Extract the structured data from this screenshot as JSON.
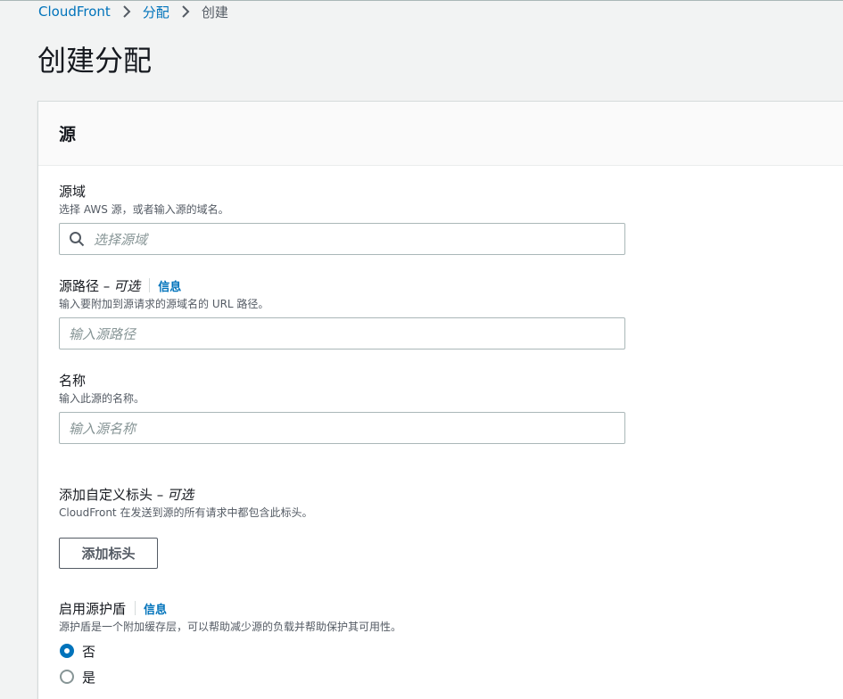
{
  "breadcrumb": {
    "items": [
      "CloudFront",
      "分配"
    ],
    "current": "创建"
  },
  "page_title": "创建分配",
  "panel": {
    "title": "源",
    "origin_domain": {
      "label": "源域",
      "description": "选择 AWS 源，或者输入源的域名。",
      "placeholder": "选择源域"
    },
    "origin_path": {
      "label": "源路径 –",
      "optional": "可选",
      "info": "信息",
      "description": "输入要附加到源请求的源域名的 URL 路径。",
      "placeholder": "输入源路径"
    },
    "name": {
      "label": "名称",
      "description": "输入此源的名称。",
      "placeholder": "输入源名称"
    },
    "custom_headers": {
      "label": "添加自定义标头 –",
      "optional": "可选",
      "description": "CloudFront 在发送到源的所有请求中都包含此标头。",
      "button": "添加标头"
    },
    "origin_shield": {
      "label": "启用源护盾",
      "info": "信息",
      "description": "源护盾是一个附加缓存层，可以帮助减少源的负载并帮助保护其可用性。",
      "options": [
        "否",
        "是"
      ],
      "selected": "否"
    }
  },
  "colors": {
    "link": "#0073bb",
    "background": "#f2f3f3",
    "panel": "#ffffff",
    "radio_selected": "#0073bb"
  }
}
